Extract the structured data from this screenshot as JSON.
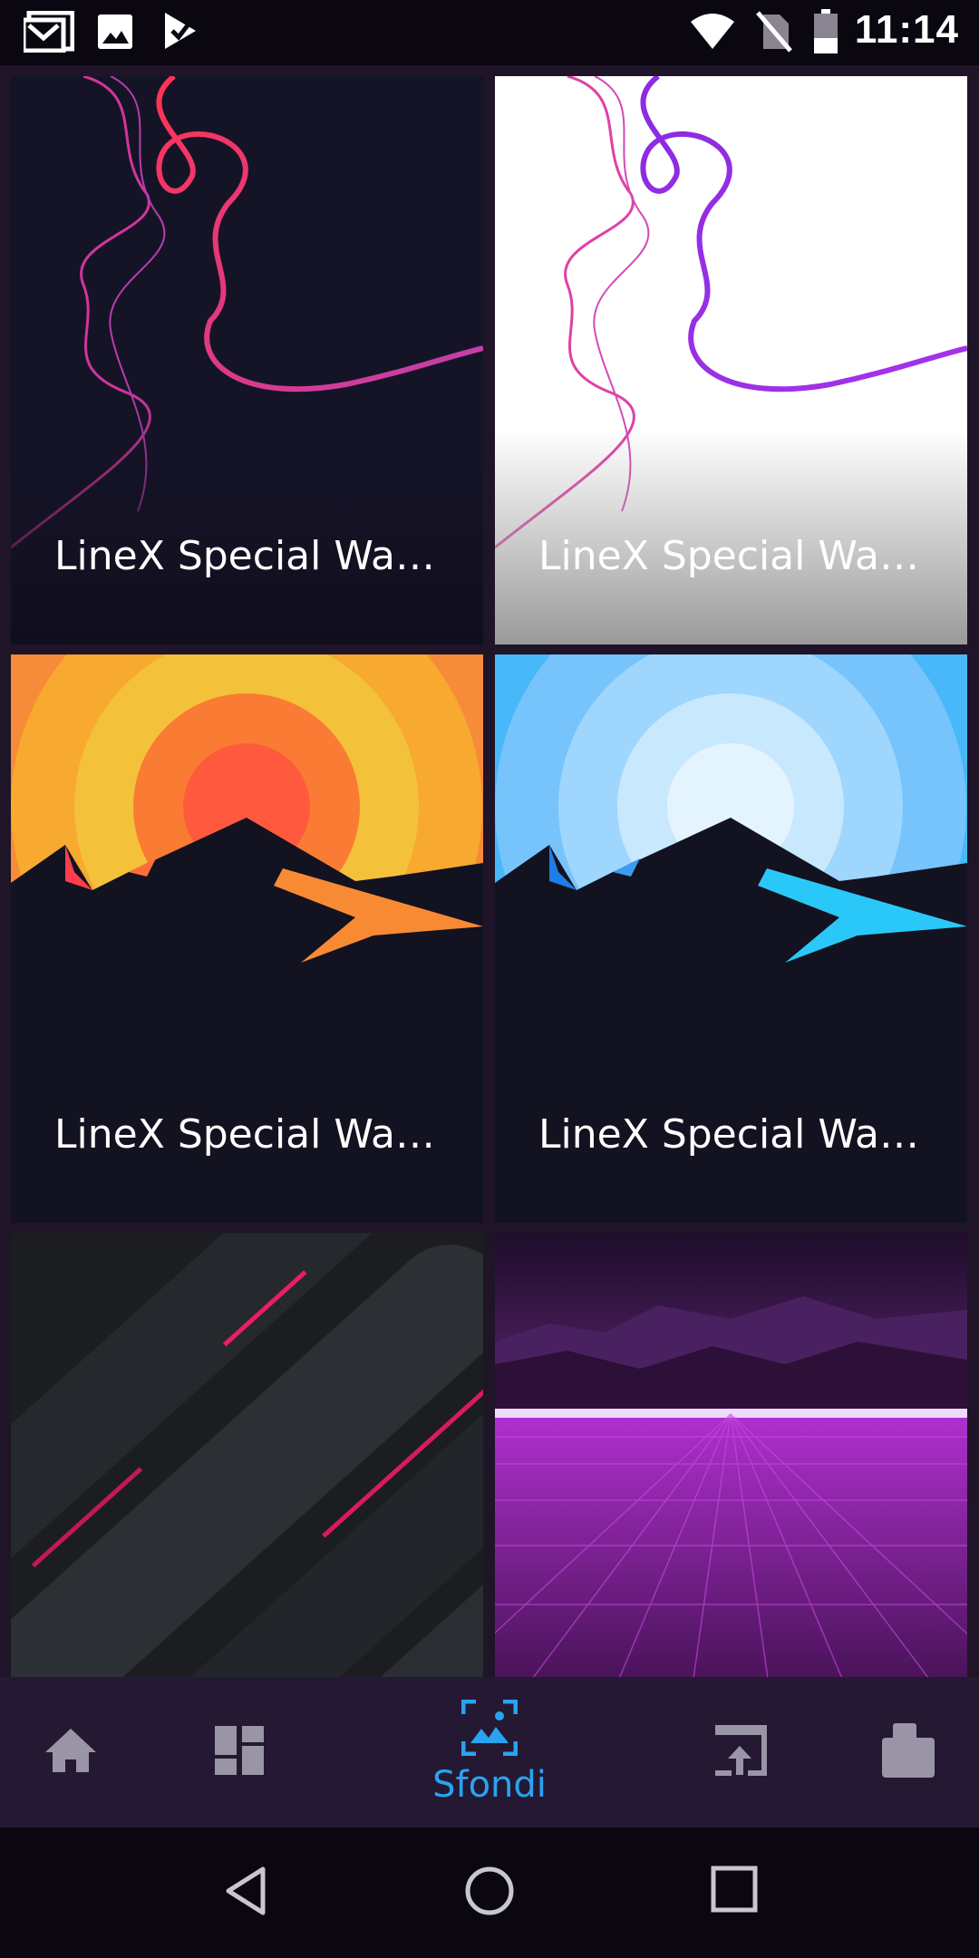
{
  "status_bar": {
    "time": "11:14",
    "left_icons": [
      "gmail-icon",
      "gallery-icon",
      "tasks-icon"
    ],
    "right_icons": [
      "wifi-icon",
      "no-sim-icon",
      "battery-icon"
    ]
  },
  "wallpapers": [
    {
      "title": "LineX Special Wa…",
      "style": "lines-dark"
    },
    {
      "title": "LineX Special Wa…",
      "style": "lines-light"
    },
    {
      "title": "LineX Special Wa…",
      "style": "mountain-orange"
    },
    {
      "title": "LineX Special Wa…",
      "style": "mountain-blue"
    },
    {
      "title": "",
      "style": "streaks-dark"
    },
    {
      "title": "",
      "style": "synthwave"
    }
  ],
  "bottom_nav": {
    "items": [
      {
        "icon": "home-icon",
        "label": ""
      },
      {
        "icon": "dashboard-icon",
        "label": ""
      },
      {
        "icon": "wallpaper-icon",
        "label": "Sfondi",
        "active": true
      },
      {
        "icon": "apply-icon",
        "label": ""
      },
      {
        "icon": "request-icon",
        "label": ""
      }
    ],
    "active_color": "#29a3f0",
    "inactive_color": "#9a95a6"
  },
  "system_nav": [
    "back-icon",
    "home-circle-icon",
    "recents-icon"
  ]
}
